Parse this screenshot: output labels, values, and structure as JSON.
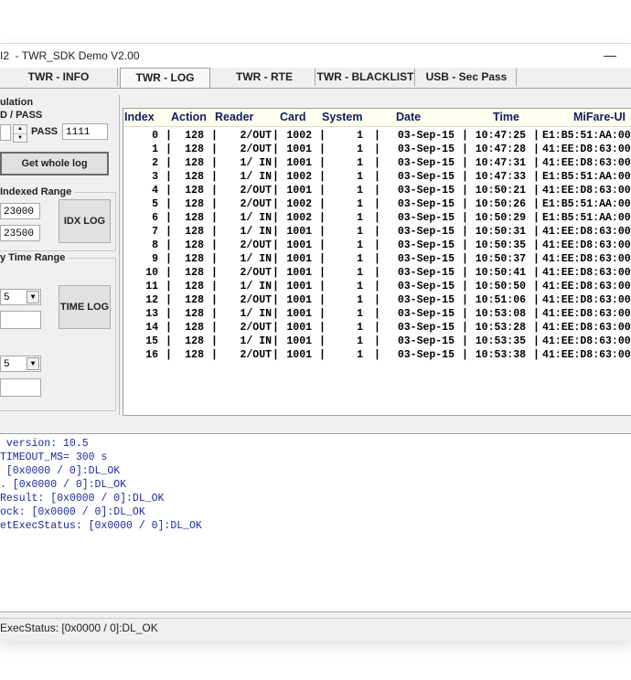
{
  "window": {
    "title": "I2  - TWR_SDK Demo V2.00",
    "minimize_glyph": "—"
  },
  "tabs": [
    {
      "label": "TWR - INFO",
      "active": false
    },
    {
      "label": "TWR - LOG",
      "active": true
    },
    {
      "label": "TWR - RTE",
      "active": false
    },
    {
      "label": "TWR - BLACKLIST",
      "active": false
    },
    {
      "label": "USB - Sec Pass",
      "active": false
    }
  ],
  "left": {
    "group_title": "ulation",
    "id_pass_label": "D / PASS",
    "pass_label": "PASS",
    "pass_value": "1111",
    "get_whole_log": "Get whole log",
    "indexed_range_label": "Indexed Range",
    "idx_from": "23000",
    "idx_to": "23500",
    "idx_log": "IDX LOG",
    "time_range_label": "y Time Range",
    "time_from_select": "5",
    "time_to_select": "5",
    "time_log": "TIME LOG"
  },
  "table": {
    "columns": [
      "Index",
      "Action",
      "Reader",
      "Card",
      "System",
      "Date",
      "Time",
      "MiFare-UI"
    ],
    "rows": [
      [
        "0",
        "128",
        "2/OUT",
        "1002",
        "1",
        "03-Sep-15",
        "10:47:25",
        "E1:B5:51:AA:00"
      ],
      [
        "1",
        "128",
        "2/OUT",
        "1001",
        "1",
        "03-Sep-15",
        "10:47:28",
        "41:EE:D8:63:00"
      ],
      [
        "2",
        "128",
        "1/ IN",
        "1001",
        "1",
        "03-Sep-15",
        "10:47:31",
        "41:EE:D8:63:00"
      ],
      [
        "3",
        "128",
        "1/ IN",
        "1002",
        "1",
        "03-Sep-15",
        "10:47:33",
        "E1:B5:51:AA:00"
      ],
      [
        "4",
        "128",
        "2/OUT",
        "1001",
        "1",
        "03-Sep-15",
        "10:50:21",
        "41:EE:D8:63:00"
      ],
      [
        "5",
        "128",
        "2/OUT",
        "1002",
        "1",
        "03-Sep-15",
        "10:50:26",
        "E1:B5:51:AA:00"
      ],
      [
        "6",
        "128",
        "1/ IN",
        "1002",
        "1",
        "03-Sep-15",
        "10:50:29",
        "E1:B5:51:AA:00"
      ],
      [
        "7",
        "128",
        "1/ IN",
        "1001",
        "1",
        "03-Sep-15",
        "10:50:31",
        "41:EE:D8:63:00"
      ],
      [
        "8",
        "128",
        "2/OUT",
        "1001",
        "1",
        "03-Sep-15",
        "10:50:35",
        "41:EE:D8:63:00"
      ],
      [
        "9",
        "128",
        "1/ IN",
        "1001",
        "1",
        "03-Sep-15",
        "10:50:37",
        "41:EE:D8:63:00"
      ],
      [
        "10",
        "128",
        "2/OUT",
        "1001",
        "1",
        "03-Sep-15",
        "10:50:41",
        "41:EE:D8:63:00"
      ],
      [
        "11",
        "128",
        "1/ IN",
        "1001",
        "1",
        "03-Sep-15",
        "10:50:50",
        "41:EE:D8:63:00"
      ],
      [
        "12",
        "128",
        "2/OUT",
        "1001",
        "1",
        "03-Sep-15",
        "10:51:06",
        "41:EE:D8:63:00"
      ],
      [
        "13",
        "128",
        "1/ IN",
        "1001",
        "1",
        "03-Sep-15",
        "10:53:08",
        "41:EE:D8:63:00"
      ],
      [
        "14",
        "128",
        "2/OUT",
        "1001",
        "1",
        "03-Sep-15",
        "10:53:28",
        "41:EE:D8:63:00"
      ],
      [
        "15",
        "128",
        "1/ IN",
        "1001",
        "1",
        "03-Sep-15",
        "10:53:35",
        "41:EE:D8:63:00"
      ],
      [
        "16",
        "128",
        "2/OUT",
        "1001",
        "1",
        "03-Sep-15",
        "10:53:38",
        "41:EE:D8:63:00"
      ]
    ]
  },
  "console": {
    "lines": [
      " version: 10.5",
      "TIMEOUT_MS= 300 s",
      " [0x0000 / 0]:DL_OK",
      ". [0x0000 / 0]:DL_OK",
      "Result: [0x0000 / 0]:DL_OK",
      "ock: [0x0000 / 0]:DL_OK",
      "etExecStatus: [0x0000 / 0]:DL_OK"
    ]
  },
  "status": {
    "text": "ExecStatus: [0x0000 / 0]:DL_OK"
  }
}
